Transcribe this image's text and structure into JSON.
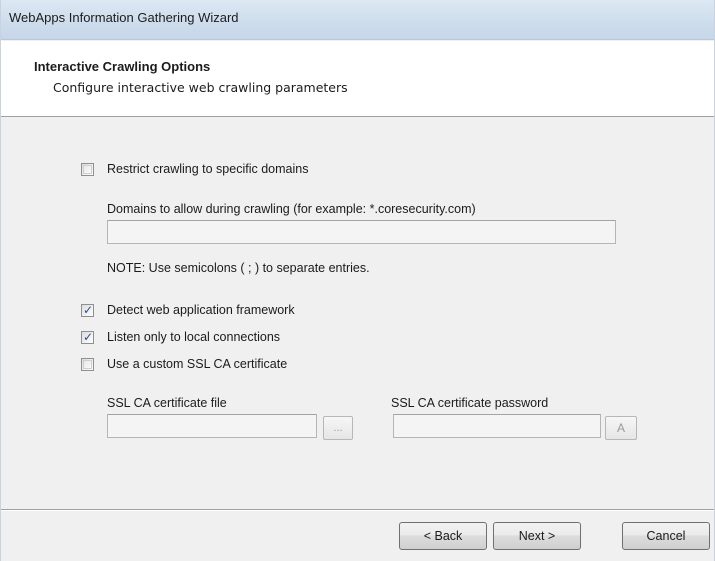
{
  "window": {
    "title": "WebApps Information Gathering Wizard"
  },
  "header": {
    "title": "Interactive Crawling Options",
    "subtitle": "Configure interactive web crawling parameters"
  },
  "options": {
    "restrict_domains": {
      "label": "Restrict crawling to specific domains",
      "checked": false
    },
    "domains_field": {
      "label": "Domains to allow during crawling (for example: *.coresecurity.com)",
      "value": ""
    },
    "note": "NOTE: Use semicolons ( ; ) to separate entries.",
    "detect_framework": {
      "label": "Detect web application framework",
      "checked": true
    },
    "listen_local": {
      "label": "Listen only to local connections",
      "checked": true
    },
    "custom_ssl": {
      "label": "Use a custom SSL CA certificate",
      "checked": false
    },
    "ssl_file": {
      "label": "SSL CA certificate file",
      "value": "",
      "browse_label": "..."
    },
    "ssl_password": {
      "label": "SSL CA certificate password",
      "value": "",
      "button_label": "A"
    }
  },
  "footer": {
    "back_label": "< Back",
    "next_label": "Next >",
    "cancel_label": "Cancel"
  },
  "colors": {
    "check_mark": "#2d4d8f",
    "titlebar": "#cddcec"
  }
}
